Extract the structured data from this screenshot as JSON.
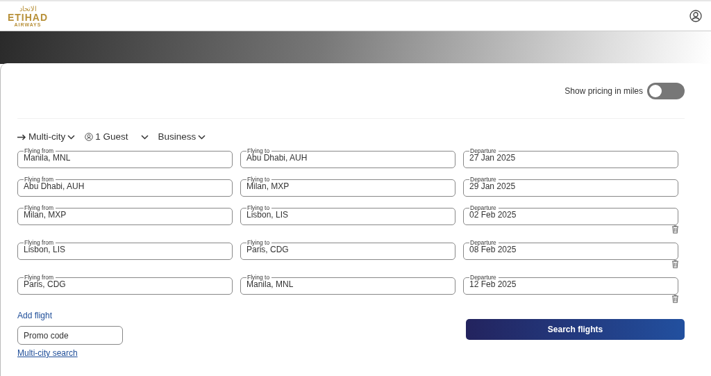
{
  "header": {
    "logo": {
      "arabic": "الاتحاد",
      "name": "ETIHAD",
      "sub": "AIRWAYS"
    }
  },
  "pricing_toggle": {
    "label": "Show pricing in miles",
    "on": false
  },
  "trip_options": [
    {
      "kind": "trip",
      "label": "Multi-city"
    },
    {
      "kind": "guests",
      "label": "1 Guest"
    },
    {
      "kind": "cabin",
      "label": "Business"
    }
  ],
  "flights": [
    {
      "from_label": "Flying from",
      "from": "Manila, MNL",
      "to_label": "Flying to",
      "to": "Abu Dhabi, AUH",
      "date_label": "Departure",
      "date": "27 Jan 2025",
      "removable": false
    },
    {
      "from_label": "Flying from",
      "from": "Abu Dhabi, AUH",
      "to_label": "Flying to",
      "to": "Milan, MXP",
      "date_label": "Departure",
      "date": "29 Jan 2025",
      "removable": false
    },
    {
      "from_label": "Flying from",
      "from": "Milan, MXP",
      "to_label": "Flying to",
      "to": "Lisbon, LIS",
      "date_label": "Departure",
      "date": "02 Feb 2025",
      "removable": true
    },
    {
      "from_label": "Flying from",
      "from": "Lisbon, LIS",
      "to_label": "Flying to",
      "to": "Paris, CDG",
      "date_label": "Departure",
      "date": "08 Feb 2025",
      "removable": true
    },
    {
      "from_label": "Flying from",
      "from": "Paris, CDG",
      "to_label": "Flying to",
      "to": "Manila, MNL",
      "date_label": "Departure",
      "date": "12 Feb 2025",
      "removable": true
    }
  ],
  "add_flight": "Add flight",
  "promo": {
    "placeholder": "Promo code"
  },
  "multi_city_link": "Multi-city search",
  "search_button": "Search flights"
}
